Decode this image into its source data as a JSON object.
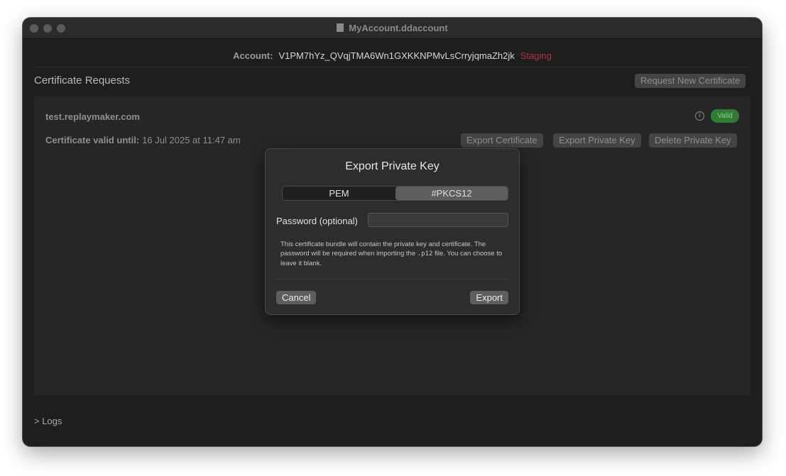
{
  "window": {
    "title": "MyAccount.ddaccount"
  },
  "account": {
    "label": "Account:",
    "id": "V1PM7hYz_QVqjTMA6Wn1GXKKNPMvLsCrryjqmaZh2jk",
    "environment": "Staging"
  },
  "certificate_requests": {
    "title": "Certificate Requests",
    "request_button": "Request New Certificate",
    "items": [
      {
        "hostname": "test.replaymaker.com",
        "status": "Valid",
        "valid_until_label": "Certificate valid until:",
        "valid_until": "16 Jul 2025 at 11:47 am",
        "actions": {
          "export_certificate": "Export Certificate",
          "export_private_key": "Export Private Key",
          "delete_private_key": "Delete Private Key"
        }
      }
    ]
  },
  "logs": {
    "label": "> Logs"
  },
  "dialog": {
    "title": "Export Private Key",
    "formats": [
      "PEM",
      "#PKCS12"
    ],
    "selected_format": "#PKCS12",
    "password_label": "Password (optional)",
    "password_value": "",
    "description_part1": "This certificate bundle will contain the private key and certificate. The password will be required when importing the ",
    "description_code": ".p12",
    "description_part2": " file. You can choose to leave it blank.",
    "cancel_label": "Cancel",
    "export_label": "Export"
  },
  "colors": {
    "window_bg": "#1e1e1e",
    "staging_red": "#b0333a",
    "valid_green": "#2e7d32"
  }
}
